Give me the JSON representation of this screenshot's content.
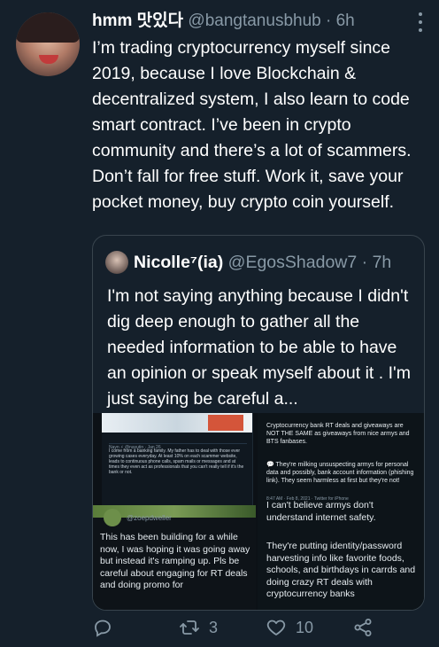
{
  "tweet": {
    "author_name": "hmm 맛있다",
    "author_handle": "@bangtanusbhub",
    "separator": " · ",
    "time": "6h",
    "text": "I’m trading cryptocurrency myself since 2019, because I love Blockchain & decentralized system, I also learn to code smart contract. I’ve been in crypto community and there’s a lot of scammers. Don’t fall for free stuff. Work it, save your pocket money, buy crypto coin yourself."
  },
  "quoted": {
    "author_name": "Nicolle⁷(ia)",
    "author_handle": "@EgosShadow7",
    "separator": " · ",
    "time": "7h",
    "text": "I'm not saying anything because I didn't dig deep enough to gather all the needed information to be able to have an opinion or speak myself about it . I'm just saying be careful a...",
    "media": {
      "shot_a_user": "Nayn ⚡ @nayutin · Jan 26",
      "shot_a_text": "I come from a banking family. My father has to deal with those ever growing cases everyday. At least 10% on each scammer website, leads to continuous phone calls, spam mails or messages and at times they even act as professionals that you can't really tell if it's the bank or not.",
      "shot_b_text_1": "Cryptocurrency bank RT deals and giveaways are NOT THE SAME as giveaways from nice armys and BTS fanbases.",
      "shot_b_text_2": "💬 They're milking unsuspecting armys for personal data and possibly, bank account information (phishing link). They seem harmless at first but they're not!",
      "shot_b_meta": "8:47 AM · Feb 8, 2021 · Twitter for iPhone",
      "shot_c_user": "@zoepdweller",
      "shot_c_text": "This has been building for a while now, I was hoping it was going away but instead it's ramping up. Pls be careful about engaging for RT deals and doing promo for",
      "shot_d_text_1": "I can't believe armys don't understand internet safety.",
      "shot_d_text_2": "They're putting identity/password harvesting info like favorite foods, schools, and birthdays in carrds and doing crazy RT deals with cryptocurrency banks"
    }
  },
  "actions": {
    "reply_count": "",
    "retweet_count": "3",
    "like_count": "10"
  },
  "icons": [
    "more-icon",
    "reply-icon",
    "retweet-icon",
    "like-icon",
    "share-icon"
  ],
  "colors": {
    "background": "#15202b",
    "secondary_text": "#8899a6",
    "border": "#38444d"
  }
}
